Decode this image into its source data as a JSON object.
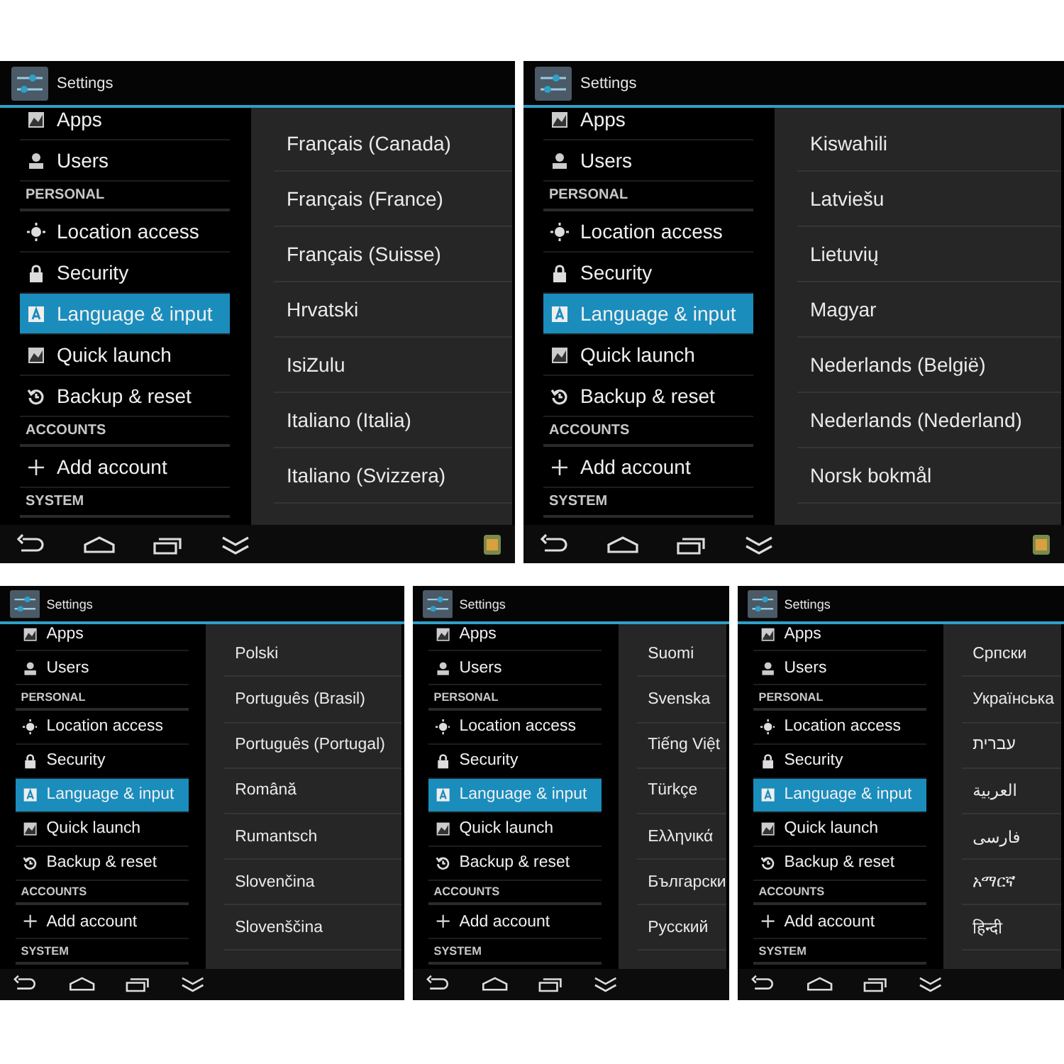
{
  "rows": [
    {
      "panels": [
        {
          "title": "Settings",
          "tray_app": true,
          "menu": [
            {
              "kind": "item",
              "label": "Apps",
              "selected": false
            },
            {
              "kind": "item",
              "label": "Users",
              "selected": false
            },
            {
              "kind": "header",
              "label": "PERSONAL"
            },
            {
              "kind": "item",
              "label": "Location access",
              "selected": false
            },
            {
              "kind": "item",
              "label": "Security",
              "selected": false
            },
            {
              "kind": "item",
              "label": "Language & input",
              "selected": true
            },
            {
              "kind": "item",
              "label": "Quick launch",
              "selected": false
            },
            {
              "kind": "item",
              "label": "Backup & reset",
              "selected": false
            },
            {
              "kind": "header",
              "label": "ACCOUNTS"
            },
            {
              "kind": "item",
              "label": "Add account",
              "selected": false
            },
            {
              "kind": "header",
              "label": "SYSTEM"
            }
          ],
          "languages": [
            "Français (Canada)",
            "Français (France)",
            "Français (Suisse)",
            "Hrvatski",
            "IsiZulu",
            "Italiano (Italia)",
            "Italiano (Svizzera)"
          ]
        },
        {
          "title": "Settings",
          "tray_app": true,
          "menu": [
            {
              "kind": "item",
              "label": "Apps",
              "selected": false
            },
            {
              "kind": "item",
              "label": "Users",
              "selected": false
            },
            {
              "kind": "header",
              "label": "PERSONAL"
            },
            {
              "kind": "item",
              "label": "Location access",
              "selected": false
            },
            {
              "kind": "item",
              "label": "Security",
              "selected": false
            },
            {
              "kind": "item",
              "label": "Language & input",
              "selected": true
            },
            {
              "kind": "item",
              "label": "Quick launch",
              "selected": false
            },
            {
              "kind": "item",
              "label": "Backup & reset",
              "selected": false
            },
            {
              "kind": "header",
              "label": "ACCOUNTS"
            },
            {
              "kind": "item",
              "label": "Add account",
              "selected": false
            },
            {
              "kind": "header",
              "label": "SYSTEM"
            }
          ],
          "languages": [
            "Kiswahili",
            "Latviešu",
            "Lietuvių",
            "Magyar",
            "Nederlands (België)",
            "Nederlands (Nederland)",
            "Norsk bokmål"
          ]
        }
      ]
    },
    {
      "panels": [
        {
          "title": "Settings",
          "menu": [
            {
              "kind": "item",
              "label": "Apps",
              "selected": false
            },
            {
              "kind": "item",
              "label": "Users",
              "selected": false
            },
            {
              "kind": "header",
              "label": "PERSONAL"
            },
            {
              "kind": "item",
              "label": "Location access",
              "selected": false
            },
            {
              "kind": "item",
              "label": "Security",
              "selected": false
            },
            {
              "kind": "item",
              "label": "Language & input",
              "selected": true
            },
            {
              "kind": "item",
              "label": "Quick launch",
              "selected": false
            },
            {
              "kind": "item",
              "label": "Backup & reset",
              "selected": false
            },
            {
              "kind": "header",
              "label": "ACCOUNTS"
            },
            {
              "kind": "item",
              "label": "Add account",
              "selected": false
            },
            {
              "kind": "header",
              "label": "SYSTEM"
            }
          ],
          "languages": [
            "Polski",
            "Português (Brasil)",
            "Português (Portugal)",
            "Română",
            "Rumantsch",
            "Slovenčina",
            "Slovenščina"
          ]
        },
        {
          "title": "Settings",
          "menu": [
            {
              "kind": "item",
              "label": "Apps",
              "selected": false
            },
            {
              "kind": "item",
              "label": "Users",
              "selected": false
            },
            {
              "kind": "header",
              "label": "PERSONAL"
            },
            {
              "kind": "item",
              "label": "Location access",
              "selected": false
            },
            {
              "kind": "item",
              "label": "Security",
              "selected": false
            },
            {
              "kind": "item",
              "label": "Language & input",
              "selected": true
            },
            {
              "kind": "item",
              "label": "Quick launch",
              "selected": false
            },
            {
              "kind": "item",
              "label": "Backup & reset",
              "selected": false
            },
            {
              "kind": "header",
              "label": "ACCOUNTS"
            },
            {
              "kind": "item",
              "label": "Add account",
              "selected": false
            },
            {
              "kind": "header",
              "label": "SYSTEM"
            }
          ],
          "languages": [
            "Suomi",
            "Svenska",
            "Tiếng Việt",
            "Türkçe",
            "Ελληνικά",
            "Български",
            "Русский"
          ]
        },
        {
          "title": "Settings",
          "menu": [
            {
              "kind": "item",
              "label": "Apps",
              "selected": false
            },
            {
              "kind": "item",
              "label": "Users",
              "selected": false
            },
            {
              "kind": "header",
              "label": "PERSONAL"
            },
            {
              "kind": "item",
              "label": "Location access",
              "selected": false
            },
            {
              "kind": "item",
              "label": "Security",
              "selected": false
            },
            {
              "kind": "item",
              "label": "Language & input",
              "selected": true
            },
            {
              "kind": "item",
              "label": "Quick launch",
              "selected": false
            },
            {
              "kind": "item",
              "label": "Backup & reset",
              "selected": false
            },
            {
              "kind": "header",
              "label": "ACCOUNTS"
            },
            {
              "kind": "item",
              "label": "Add account",
              "selected": false
            },
            {
              "kind": "header",
              "label": "SYSTEM"
            }
          ],
          "languages": [
            "Српски",
            "Українська",
            "עברית",
            "العربية",
            "فارسی",
            "አማርኛ",
            "हिन्दी"
          ]
        }
      ]
    }
  ]
}
